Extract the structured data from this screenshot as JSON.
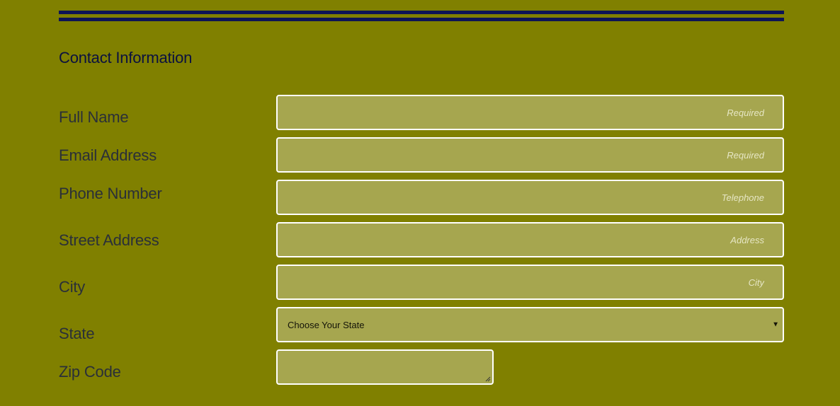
{
  "section": {
    "title": "Contact Information"
  },
  "fields": {
    "full_name": {
      "label": "Full Name",
      "placeholder": "Required",
      "value": ""
    },
    "email": {
      "label": "Email Address",
      "placeholder": "Required",
      "value": ""
    },
    "phone": {
      "label": "Phone Number",
      "placeholder": "Telephone",
      "value": ""
    },
    "street": {
      "label": "Street Address",
      "placeholder": "Address",
      "value": ""
    },
    "city": {
      "label": "City",
      "placeholder": "City",
      "value": ""
    },
    "state": {
      "label": "State",
      "selected": "Choose Your State"
    },
    "zip": {
      "label": "Zip Code",
      "value": ""
    }
  },
  "colors": {
    "background": "#808000",
    "rule": "#0d1456",
    "field_fill": "#a6a64f",
    "field_border": "#ffffff",
    "placeholder": "#e6e6c4"
  },
  "icons": {
    "state_dropdown": "triangle-down-icon",
    "zip_resize": "resize-grip-icon"
  }
}
